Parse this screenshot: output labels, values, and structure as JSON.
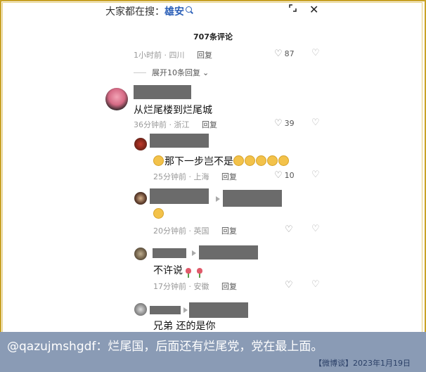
{
  "search": {
    "prefix": "大家都在搜：",
    "keyword": "雄安"
  },
  "comments_header": {
    "title": "707条评论"
  },
  "reply_label": "回复",
  "top_comment": {
    "time": "1小时前",
    "location": "四川",
    "likes": "87"
  },
  "expand_replies": {
    "label": "展开10条回复"
  },
  "comments": [
    {
      "text": "从烂尾楼到烂尾城",
      "time": "36分钟前",
      "location": "浙江",
      "likes": "39"
    },
    {
      "text": "那下一步岂不是",
      "time": "25分钟前",
      "location": "上海",
      "likes": "10"
    },
    {
      "text": "",
      "time": "20分钟前",
      "location": "英国",
      "likes": ""
    },
    {
      "text": "不许说",
      "time": "17分钟前",
      "location": "安徽",
      "likes": ""
    },
    {
      "text": "兄弟 还的是你",
      "time": "",
      "location": "",
      "likes": ""
    }
  ],
  "caption": {
    "text": "@qazujmshgdf：烂尾国，后面还有烂尾党，党在最上面。",
    "date": "【微博谈】2023年1月19日"
  },
  "colors": {
    "caption_bg": "#8a9bb5",
    "frame": "#c9a227",
    "keyword": "#2b5fb8"
  }
}
